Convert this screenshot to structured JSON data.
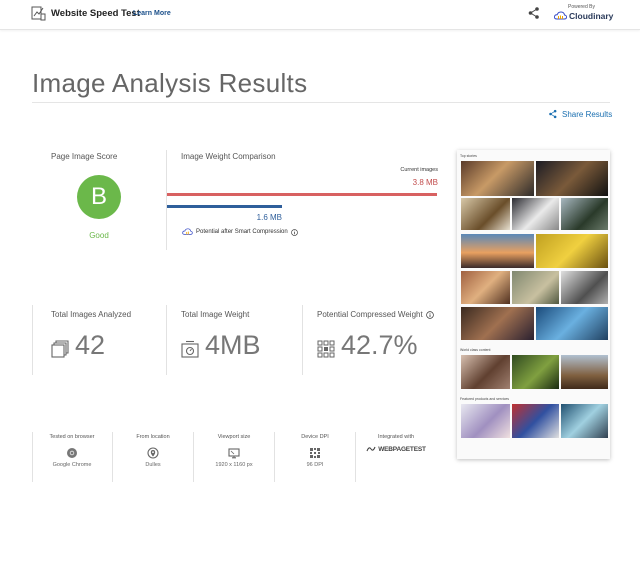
{
  "header": {
    "app_title": "Website Speed Test",
    "learn_more": "Learn More",
    "powered_by": "Powered By",
    "brand_name": "Cloudinary"
  },
  "page_title": "Image Analysis Results",
  "share_results": "Share Results",
  "score": {
    "label": "Page Image Score",
    "grade": "B",
    "grade_text": "Good",
    "grade_color": "#6bb84a"
  },
  "weight_comparison": {
    "label": "Image Weight Comparison",
    "current_label": "Current images",
    "current_value": "3.8 MB",
    "potential_value": "1.6 MB",
    "potential_caption": "Potential after Smart Compression",
    "current_color": "#d86161",
    "potential_color": "#2f5f9b"
  },
  "stats": [
    {
      "label": "Total Images Analyzed",
      "value": "42",
      "icon": "stacked-images-icon"
    },
    {
      "label": "Total Image Weight",
      "value": "4MB",
      "icon": "weight-scale-icon"
    },
    {
      "label": "Potential Compressed Weight",
      "value": "42.7%",
      "icon": "grid-compression-icon"
    }
  ],
  "environment": [
    {
      "label": "Tested on browser",
      "value": "Google Chrome",
      "icon": "chrome-icon"
    },
    {
      "label": "From location",
      "value": "Dulles",
      "icon": "location-pin-icon"
    },
    {
      "label": "Viewport size",
      "value": "1920 x 1160 px",
      "icon": "viewport-icon"
    },
    {
      "label": "Device DPI",
      "value": "96 DPI",
      "icon": "dpi-grid-icon"
    },
    {
      "label": "Integrated with",
      "value": "WEBPAGETEST",
      "icon": "webpagetest-logo"
    }
  ],
  "thumbnail": {
    "section_top": "Top stories",
    "section_world": "World class content",
    "section_featured": "Featured products and services"
  }
}
